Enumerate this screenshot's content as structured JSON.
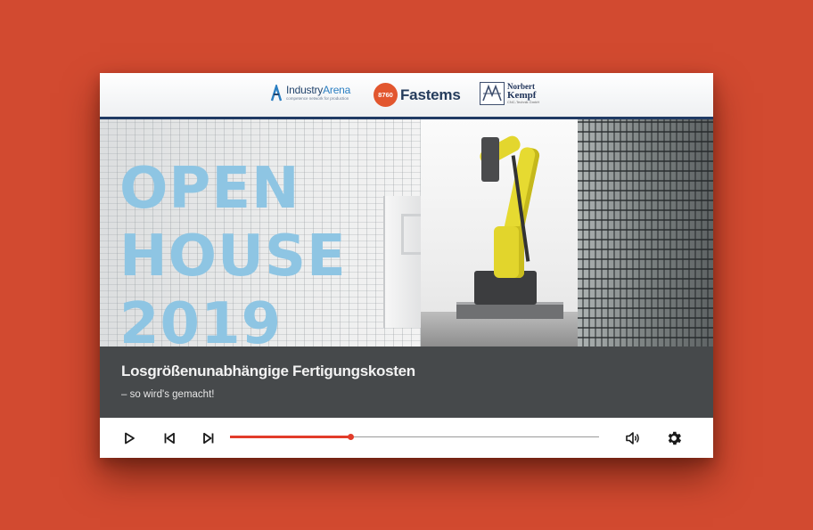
{
  "logos": {
    "industry_arena": {
      "name_a": "Industry",
      "name_b": "Arena",
      "tagline": "competence network for production"
    },
    "fastems": {
      "badge": "8760",
      "name": "Fastems"
    },
    "norbert_kempf": {
      "line1": "Norbert",
      "line2": "Kempf",
      "line3": "CNC-Technik GmbH"
    }
  },
  "hero": {
    "title": "OPEN\nHOUSE\n2019"
  },
  "caption": {
    "title": "Losgrößenunabhängige Fertigungskosten",
    "subtitle": "– so wird's gemacht!"
  },
  "player": {
    "progress": 0.325,
    "controls": [
      "play-icon",
      "skip-previous-icon",
      "skip-next-icon",
      "volume-icon",
      "settings-icon"
    ],
    "accent_color": "#e23c2a",
    "background_color": "#d24a30"
  }
}
